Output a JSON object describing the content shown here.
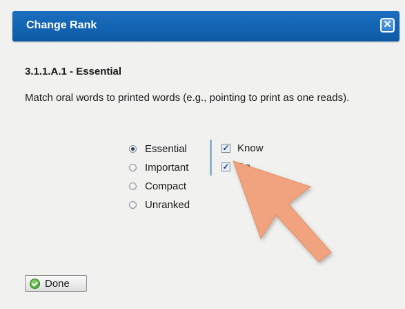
{
  "dialog": {
    "title": "Change Rank",
    "close_symbol": "✕"
  },
  "standard": {
    "code_rank": "3.1.1.A.1 - Essential",
    "description": "Match oral words to printed words (e.g., pointing to print as one reads)."
  },
  "rank_options": [
    {
      "label": "Essential",
      "selected": true
    },
    {
      "label": "Important",
      "selected": false
    },
    {
      "label": "Compact",
      "selected": false
    },
    {
      "label": "Unranked",
      "selected": false
    }
  ],
  "type_options": [
    {
      "label": "Know",
      "checked": true
    },
    {
      "label": "Do",
      "checked": true
    }
  ],
  "footer": {
    "done_label": "Done"
  },
  "colors": {
    "titlebar": "#0c5aa6",
    "arrow": "#f0a37e",
    "divider": "#8fb3c8"
  },
  "icons": {
    "close": "close-icon",
    "done": "check-circle-icon",
    "annotation": "arrow-pointer"
  }
}
